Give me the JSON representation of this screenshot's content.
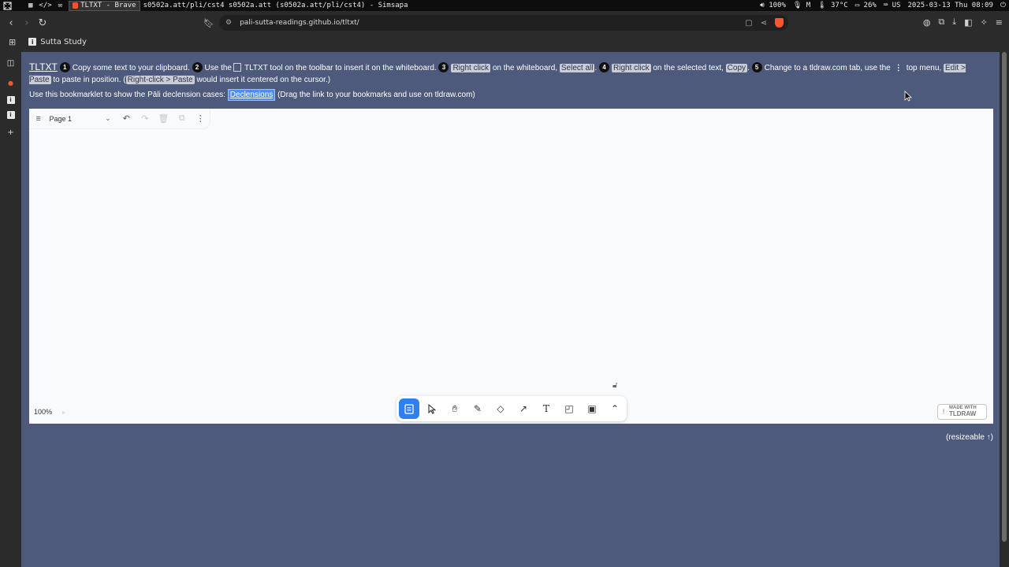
{
  "system_bar": {
    "window_title": "TLTXT - Brave",
    "other_window": "s0502a.att/pli/cst4 s0502a.att (s0502a.att/pli/cst4) - Simsapa",
    "volume": "100%",
    "mic": "M",
    "temperature": "37°C",
    "battery": "26%",
    "keyboard_layout": "US",
    "datetime": "2025-03-13 Thu 08:09"
  },
  "browser": {
    "url": "pali-sutta-readings.github.io/tltxt/",
    "bookmark_label": "Sutta Study"
  },
  "page": {
    "title_link": "TLTXT",
    "steps": [
      {
        "num": "1",
        "text": "Copy some text to your clipboard."
      },
      {
        "num": "2",
        "pre": "Use the",
        "post": "TLTXT tool on the toolbar to insert it on the whiteboard."
      },
      {
        "num": "3",
        "kbd1": "Right click",
        "mid": "on the whiteboard,",
        "kbd2": "Select all",
        "end": "."
      },
      {
        "num": "4",
        "kbd1": "Right click",
        "mid": "on the selected text,",
        "kbd2": "Copy",
        "end": "."
      },
      {
        "num": "5",
        "pre": "Change to a tldraw.com tab, use the",
        "post": "top menu,",
        "kbd1": "Edit > Paste",
        "mid": "to paste in position. (",
        "kbd2": "Right-click > Paste",
        "end": "would insert it centered on the cursor.)"
      }
    ],
    "bookmarklet_pre": "Use this bookmarklet to show the Pāli declension cases:",
    "bookmarklet_link": "Declensions",
    "bookmarklet_post": "(Drag the link to your bookmarks and use on tldraw.com)",
    "resizeable_note": "(resizeable ↑)"
  },
  "whiteboard": {
    "page_name": "Page 1",
    "zoom": "100%",
    "made_with_line1": "MADE WITH",
    "made_with_line2": "TLDRAW",
    "tools": [
      "tltxt-icon",
      "select-icon",
      "hand-icon",
      "draw-icon",
      "eraser-icon",
      "arrow-icon",
      "text-icon",
      "note-icon",
      "image-icon",
      "more-tools-icon"
    ],
    "active_tool": "tltxt-icon"
  },
  "colors": {
    "page_background": "#4d5a7c",
    "accent": "#2f80ed",
    "link_highlight": "#4f8ef7"
  }
}
